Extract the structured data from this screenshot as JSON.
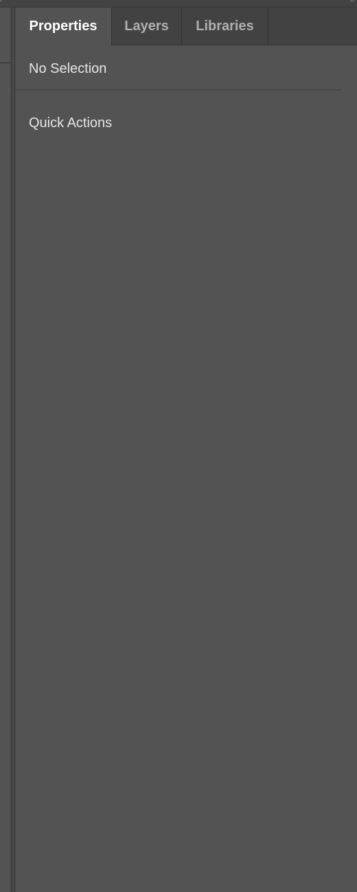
{
  "tabs": [
    {
      "label": "Properties",
      "active": true
    },
    {
      "label": "Layers",
      "active": false
    },
    {
      "label": "Libraries",
      "active": false
    }
  ],
  "panel": {
    "selection_status": "No Selection",
    "quick_actions_label": "Quick Actions"
  },
  "chrome": {
    "collapse_left_glyph": "‹",
    "collapse_right_glyph": "››"
  },
  "colors": {
    "panel_bg": "#535353",
    "tabbar_bg": "#424242",
    "active_tab_text": "#ffffff",
    "inactive_tab_text": "#b0b0b0"
  }
}
